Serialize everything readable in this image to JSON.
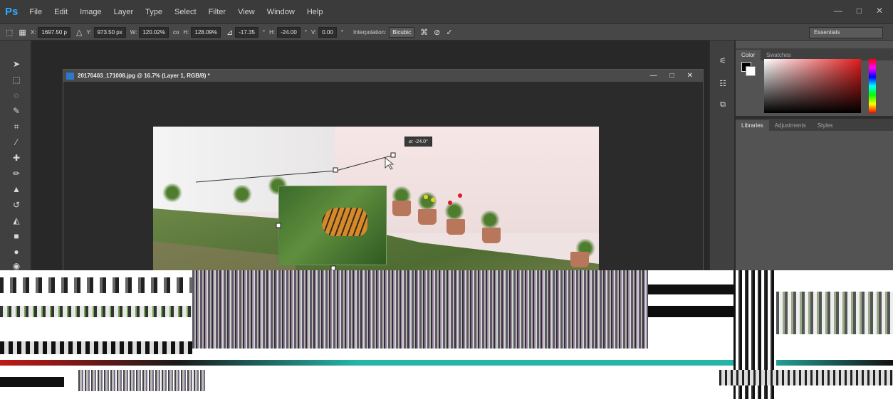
{
  "app": {
    "logo": "Ps",
    "menu": [
      "File",
      "Edit",
      "Image",
      "Layer",
      "Type",
      "Select",
      "Filter",
      "View",
      "Window",
      "Help"
    ],
    "window_controls": [
      "—",
      "□",
      "✕"
    ]
  },
  "options_bar": {
    "x_label": "X:",
    "x_value": "1697.50 p",
    "y_label": "Y:",
    "y_value": "973.50 px",
    "w_label": "W:",
    "w_value": "120.02%",
    "link_label": "co",
    "h_label": "H:",
    "h_value": "128.09%",
    "angle_value": "-17.35",
    "angle_unit": "°",
    "hskew_label": "H:",
    "hskew_value": "-24.00",
    "hskew_unit": "°",
    "vskew_label": "V:",
    "vskew_value": "0.00",
    "vskew_unit": "°",
    "interp_label": "Interpolation:",
    "interp_value": "Bicubic",
    "workspace_value": "Essentials"
  },
  "document": {
    "title": "20170403_171008.jpg @ 16.7% (Layer 1, RGB/8) *",
    "controls": [
      "—",
      "□",
      "✕"
    ],
    "angle_tooltip": "⌀: -24.0°"
  },
  "panels": {
    "color_tabs": [
      "Color",
      "Swatches"
    ],
    "library_tabs": [
      "Libraries",
      "Adjustments",
      "Styles"
    ]
  },
  "colors": {
    "accent": "#31a8ff",
    "foreground": "#000000",
    "background": "#ffffff"
  }
}
